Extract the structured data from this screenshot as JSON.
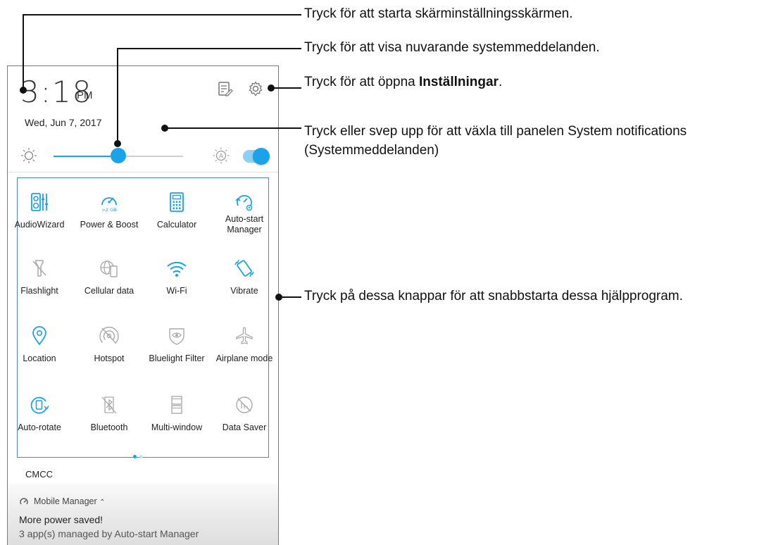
{
  "phone": {
    "clock_time": "3:18",
    "clock_ampm": "PM",
    "date": "Wed, Jun 7, 2017",
    "brightness_level": 0.5,
    "auto_brightness_on": true,
    "accent_color": "#1aa3e8",
    "tiles": [
      {
        "label": "AudioWizard",
        "icon": "audiowizard-icon",
        "active": true
      },
      {
        "label": "Power & Boost",
        "icon": "power-boost-icon",
        "active": true
      },
      {
        "label": "Calculator",
        "icon": "calculator-icon",
        "active": true
      },
      {
        "label": "Auto-start Manager",
        "icon": "auto-start-manager-icon",
        "active": true
      },
      {
        "label": "Flashlight",
        "icon": "flashlight-off-icon",
        "active": false
      },
      {
        "label": "Cellular data",
        "icon": "cellular-data-icon",
        "active": false
      },
      {
        "label": "Wi-Fi",
        "icon": "wifi-icon",
        "active": true
      },
      {
        "label": "Vibrate",
        "icon": "vibrate-icon",
        "active": true
      },
      {
        "label": "Location",
        "icon": "location-icon",
        "active": true
      },
      {
        "label": "Hotspot",
        "icon": "hotspot-off-icon",
        "active": false
      },
      {
        "label": "Bluelight Filter",
        "icon": "bluelight-filter-icon",
        "active": false
      },
      {
        "label": "Airplane mode",
        "icon": "airplane-icon",
        "active": false
      },
      {
        "label": "Auto-rotate",
        "icon": "auto-rotate-icon",
        "active": true
      },
      {
        "label": "Bluetooth",
        "icon": "bluetooth-off-icon",
        "active": false
      },
      {
        "label": "Multi-window",
        "icon": "multi-window-icon",
        "active": false
      },
      {
        "label": "Data Saver",
        "icon": "data-saver-off-icon",
        "active": false
      }
    ],
    "carrier": "CMCC",
    "notification": {
      "app": "Mobile Manager",
      "title": "More power saved!",
      "body": "3 app(s) managed by Auto-start Manager"
    }
  },
  "callouts": {
    "screen_settings": "Tryck för att starta skärminställningsskärmen.",
    "system_notifications": "Tryck för att visa nuvarande systemmeddelanden.",
    "settings_prefix": "Tryck för att öppna ",
    "settings_bold": "Inställningar",
    "settings_suffix": ".",
    "swipe_line1": "Tryck eller svep upp för att växla till panelen System notifications",
    "swipe_line2": "(Systemmeddelanden)",
    "quick_buttons": "Tryck på dessa knappar för att snabbstarta dessa hjälpprogram."
  }
}
